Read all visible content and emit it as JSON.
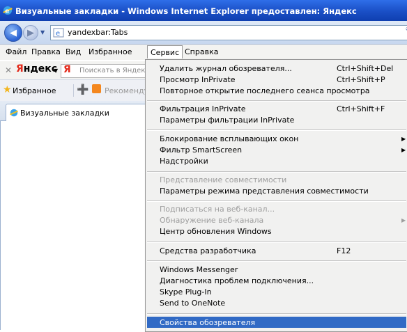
{
  "window": {
    "title": "Визуальные закладки - Windows Internet Explorer предоставлен: Яндекс"
  },
  "address": {
    "url": "yandexbar:Tabs",
    "right_fragment": "Ÿ"
  },
  "menu": {
    "items": [
      "Файл",
      "Правка",
      "Вид",
      "Избранное",
      "Сервис",
      "Справка"
    ],
    "active": "Сервис"
  },
  "yandex_bar": {
    "brand_first": "Я",
    "brand_rest": "ндекс",
    "search_logo": "Я",
    "search_placeholder": "Поискать в Яндексе"
  },
  "favorites_bar": {
    "favorites_label": "Избранное",
    "recommended_label": "Рекомендуемые"
  },
  "tab": {
    "label": "Визуальные закладки"
  },
  "tools_menu": {
    "items": [
      {
        "label": "Удалить журнал обозревателя...",
        "shortcut": "Ctrl+Shift+Del"
      },
      {
        "label": "Просмотр InPrivate",
        "shortcut": "Ctrl+Shift+P"
      },
      {
        "label": "Повторное открытие последнего сеанса просмотра"
      },
      {
        "label": "Фильтрация InPrivate",
        "shortcut": "Ctrl+Shift+F"
      },
      {
        "label": "Параметры фильтрации InPrivate"
      },
      {
        "label": "Блокирование всплывающих окон",
        "submenu": true
      },
      {
        "label": "Фильтр SmartScreen",
        "submenu": true
      },
      {
        "label": "Надстройки"
      },
      {
        "label": "Представление совместимости",
        "disabled": true
      },
      {
        "label": "Параметры режима представления совместимости"
      },
      {
        "label": "Подписаться на веб-канал...",
        "disabled": true
      },
      {
        "label": "Обнаружение веб-канала",
        "disabled": true,
        "submenu": true
      },
      {
        "label": "Центр обновления Windows"
      },
      {
        "label": "Средства разработчика",
        "shortcut": "F12"
      },
      {
        "label": "Windows Messenger"
      },
      {
        "label": "Диагностика проблем подключения..."
      },
      {
        "label": "Skype Plug-In"
      },
      {
        "label": "Send to OneNote"
      },
      {
        "label": "Свойства обозревателя",
        "highlighted": true
      }
    ]
  },
  "colors": {
    "titlebar": "#1a4fc6",
    "highlight": "#316ac5",
    "yandex_red": "#e32b1c"
  },
  "icons": [
    "ie-icon",
    "back-arrow-icon",
    "forward-arrow-icon",
    "page-icon",
    "close-icon",
    "favorites-star-icon",
    "add-favorite-icon",
    "rss-icon",
    "submenu-arrow-icon"
  ]
}
